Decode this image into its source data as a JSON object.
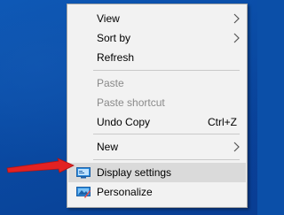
{
  "context_menu": {
    "items": [
      {
        "label": "View",
        "has_submenu": true
      },
      {
        "label": "Sort by",
        "has_submenu": true
      },
      {
        "label": "Refresh"
      },
      {
        "label": "Paste",
        "disabled": true
      },
      {
        "label": "Paste shortcut",
        "disabled": true
      },
      {
        "label": "Undo Copy",
        "shortcut": "Ctrl+Z"
      },
      {
        "label": "New",
        "has_submenu": true
      },
      {
        "label": "Display settings",
        "icon": "display-settings-icon",
        "highlighted": true
      },
      {
        "label": "Personalize",
        "icon": "personalize-icon"
      }
    ]
  },
  "annotation": {
    "arrow_color": "#e32222"
  },
  "colors": {
    "desktop": "#0b4fa8",
    "menu_bg": "#f2f2f2",
    "highlight": "#dadada"
  }
}
